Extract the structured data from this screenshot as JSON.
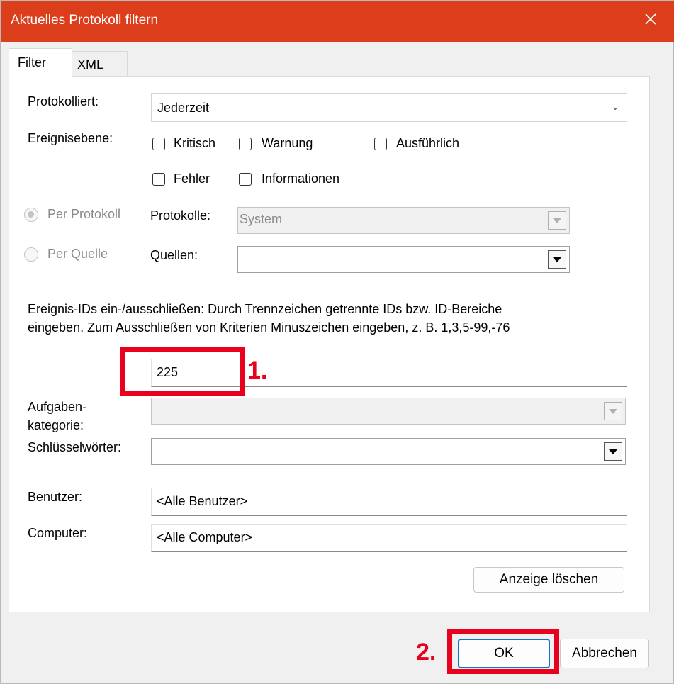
{
  "window": {
    "title": "Aktuelles Protokoll filtern"
  },
  "tabs": [
    "Filter",
    "XML"
  ],
  "form": {
    "logged_label": "Protokolliert:",
    "logged_value": "Jederzeit",
    "event_level_label": "Ereignisebene:",
    "levels": {
      "critical": "Kritisch",
      "warning": "Warnung",
      "verbose": "Ausführlich",
      "error": "Fehler",
      "information": "Informationen"
    },
    "by_log_label": "Per Protokoll",
    "by_source_label": "Per Quelle",
    "logs_label": "Protokolle:",
    "logs_value": "System",
    "sources_label": "Quellen:",
    "sources_value": "",
    "event_ids_description_line1": "Ereignis-IDs ein-/ausschließen: Durch Trennzeichen getrennte IDs bzw. ID-Bereiche",
    "event_ids_description_line2": "eingeben. Zum Ausschließen von Kriterien Minuszeichen eingeben, z. B. 1,3,5-99,-76",
    "event_ids_value": "225",
    "task_category_label_line1": "Aufgaben-",
    "task_category_label_line2": "kategorie:",
    "keywords_label": "Schlüsselwörter:",
    "user_label": "Benutzer:",
    "user_value": "<Alle Benutzer>",
    "computer_label": "Computer:",
    "computer_value": "<Alle Computer>",
    "clear_button": "Anzeige löschen"
  },
  "footer": {
    "ok_button": "OK",
    "cancel_button": "Abbrechen"
  },
  "annotations": {
    "step1": "1.",
    "step2": "2.",
    "color": "#e8001c"
  }
}
